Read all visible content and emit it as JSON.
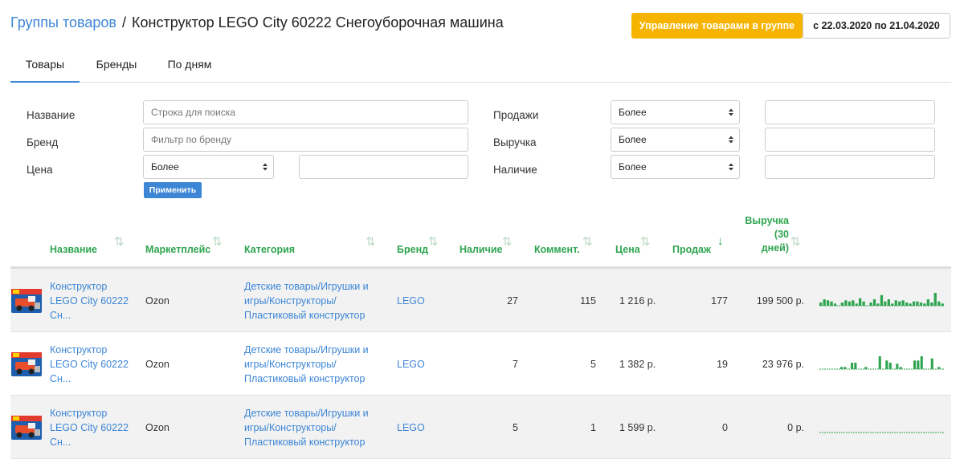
{
  "header": {
    "breadcrumb_link": "Группы товаров",
    "separator": "/",
    "title": "Конструктор LEGO City 60222 Снегоуборочная машина",
    "manage_button": "Управление товарами в группе",
    "date_range": "с 22.03.2020 по 21.04.2020"
  },
  "tabs": [
    {
      "label": "Товары",
      "active": true
    },
    {
      "label": "Бренды",
      "active": false
    },
    {
      "label": "По дням",
      "active": false
    }
  ],
  "filters": {
    "name_label": "Название",
    "name_placeholder": "Строка для поиска",
    "brand_label": "Бренд",
    "brand_placeholder": "Фильтр по бренду",
    "price_label": "Цена",
    "price_select": "Более",
    "sales_label": "Продажи",
    "sales_select": "Более",
    "revenue_label": "Выручка",
    "revenue_select": "Более",
    "stock_label": "Наличие",
    "stock_select": "Более",
    "apply_button": "Применить"
  },
  "columns": {
    "name": "Название",
    "marketplace": "Маркетплейс",
    "category": "Категория",
    "brand": "Бренд",
    "stock": "Наличие",
    "comments": "Коммент.",
    "price": "Цена",
    "sales": "Продаж",
    "revenue_line1": "Выручка",
    "revenue_line2": "(30",
    "revenue_line3": "дней)"
  },
  "colors": {
    "accent": "#3d86d6",
    "header_green": "#2ea44f",
    "manage_button": "#f6b400",
    "spark_green": "#2ea44f"
  },
  "rows": [
    {
      "name_line1": "Конструктор",
      "name_line2": "LEGO City 60222",
      "name_line3": "Сн...",
      "marketplace": "Ozon",
      "category_line1": "Детские товары/Игрушки и",
      "category_line2": "игры/Конструкторы/",
      "category_line3": "Пластиковый конструктор",
      "brand": "LEGO",
      "stock": "27",
      "comments": "115",
      "price": "1 216 р.",
      "sales": "177",
      "revenue": "199 500 р.",
      "spark": [
        3,
        6,
        5,
        4,
        2,
        0,
        3,
        5,
        4,
        5,
        2,
        7,
        4,
        0,
        3,
        6,
        2,
        10,
        4,
        6,
        2,
        5,
        4,
        5,
        3,
        2,
        4,
        4,
        3,
        2,
        6,
        3,
        12,
        4,
        2
      ]
    },
    {
      "name_line1": "Конструктор",
      "name_line2": "LEGO City 60222",
      "name_line3": "Сн...",
      "marketplace": "Ozon",
      "category_line1": "Детские товары/Игрушки и",
      "category_line2": "игры/Конструкторы/",
      "category_line3": "Пластиковый конструктор",
      "brand": "LEGO",
      "stock": "7",
      "comments": "5",
      "price": "1 382 р.",
      "sales": "19",
      "revenue": "23 976 р.",
      "spark": [
        0,
        0,
        0,
        0,
        0,
        0,
        2,
        2,
        0,
        6,
        6,
        0,
        0,
        2,
        0,
        0,
        0,
        12,
        0,
        8,
        6,
        0,
        5,
        2,
        0,
        0,
        0,
        8,
        8,
        12,
        0,
        0,
        10,
        0,
        2,
        0
      ]
    },
    {
      "name_line1": "Конструктор",
      "name_line2": "LEGO City 60222",
      "name_line3": "Сн...",
      "marketplace": "Ozon",
      "category_line1": "Детские товары/Игрушки и",
      "category_line2": "игры/Конструкторы/",
      "category_line3": "Пластиковый конструктор",
      "brand": "LEGO",
      "stock": "5",
      "comments": "1",
      "price": "1 599 р.",
      "sales": "0",
      "revenue": "0 р.",
      "spark": [
        0,
        0,
        0,
        0,
        0,
        0,
        0,
        0,
        0,
        0,
        0,
        0,
        0,
        0,
        0,
        0,
        0,
        0,
        0,
        0,
        0,
        0,
        0,
        0,
        0,
        0,
        0,
        0,
        0,
        0,
        0,
        0,
        0,
        0,
        0,
        0
      ]
    }
  ]
}
